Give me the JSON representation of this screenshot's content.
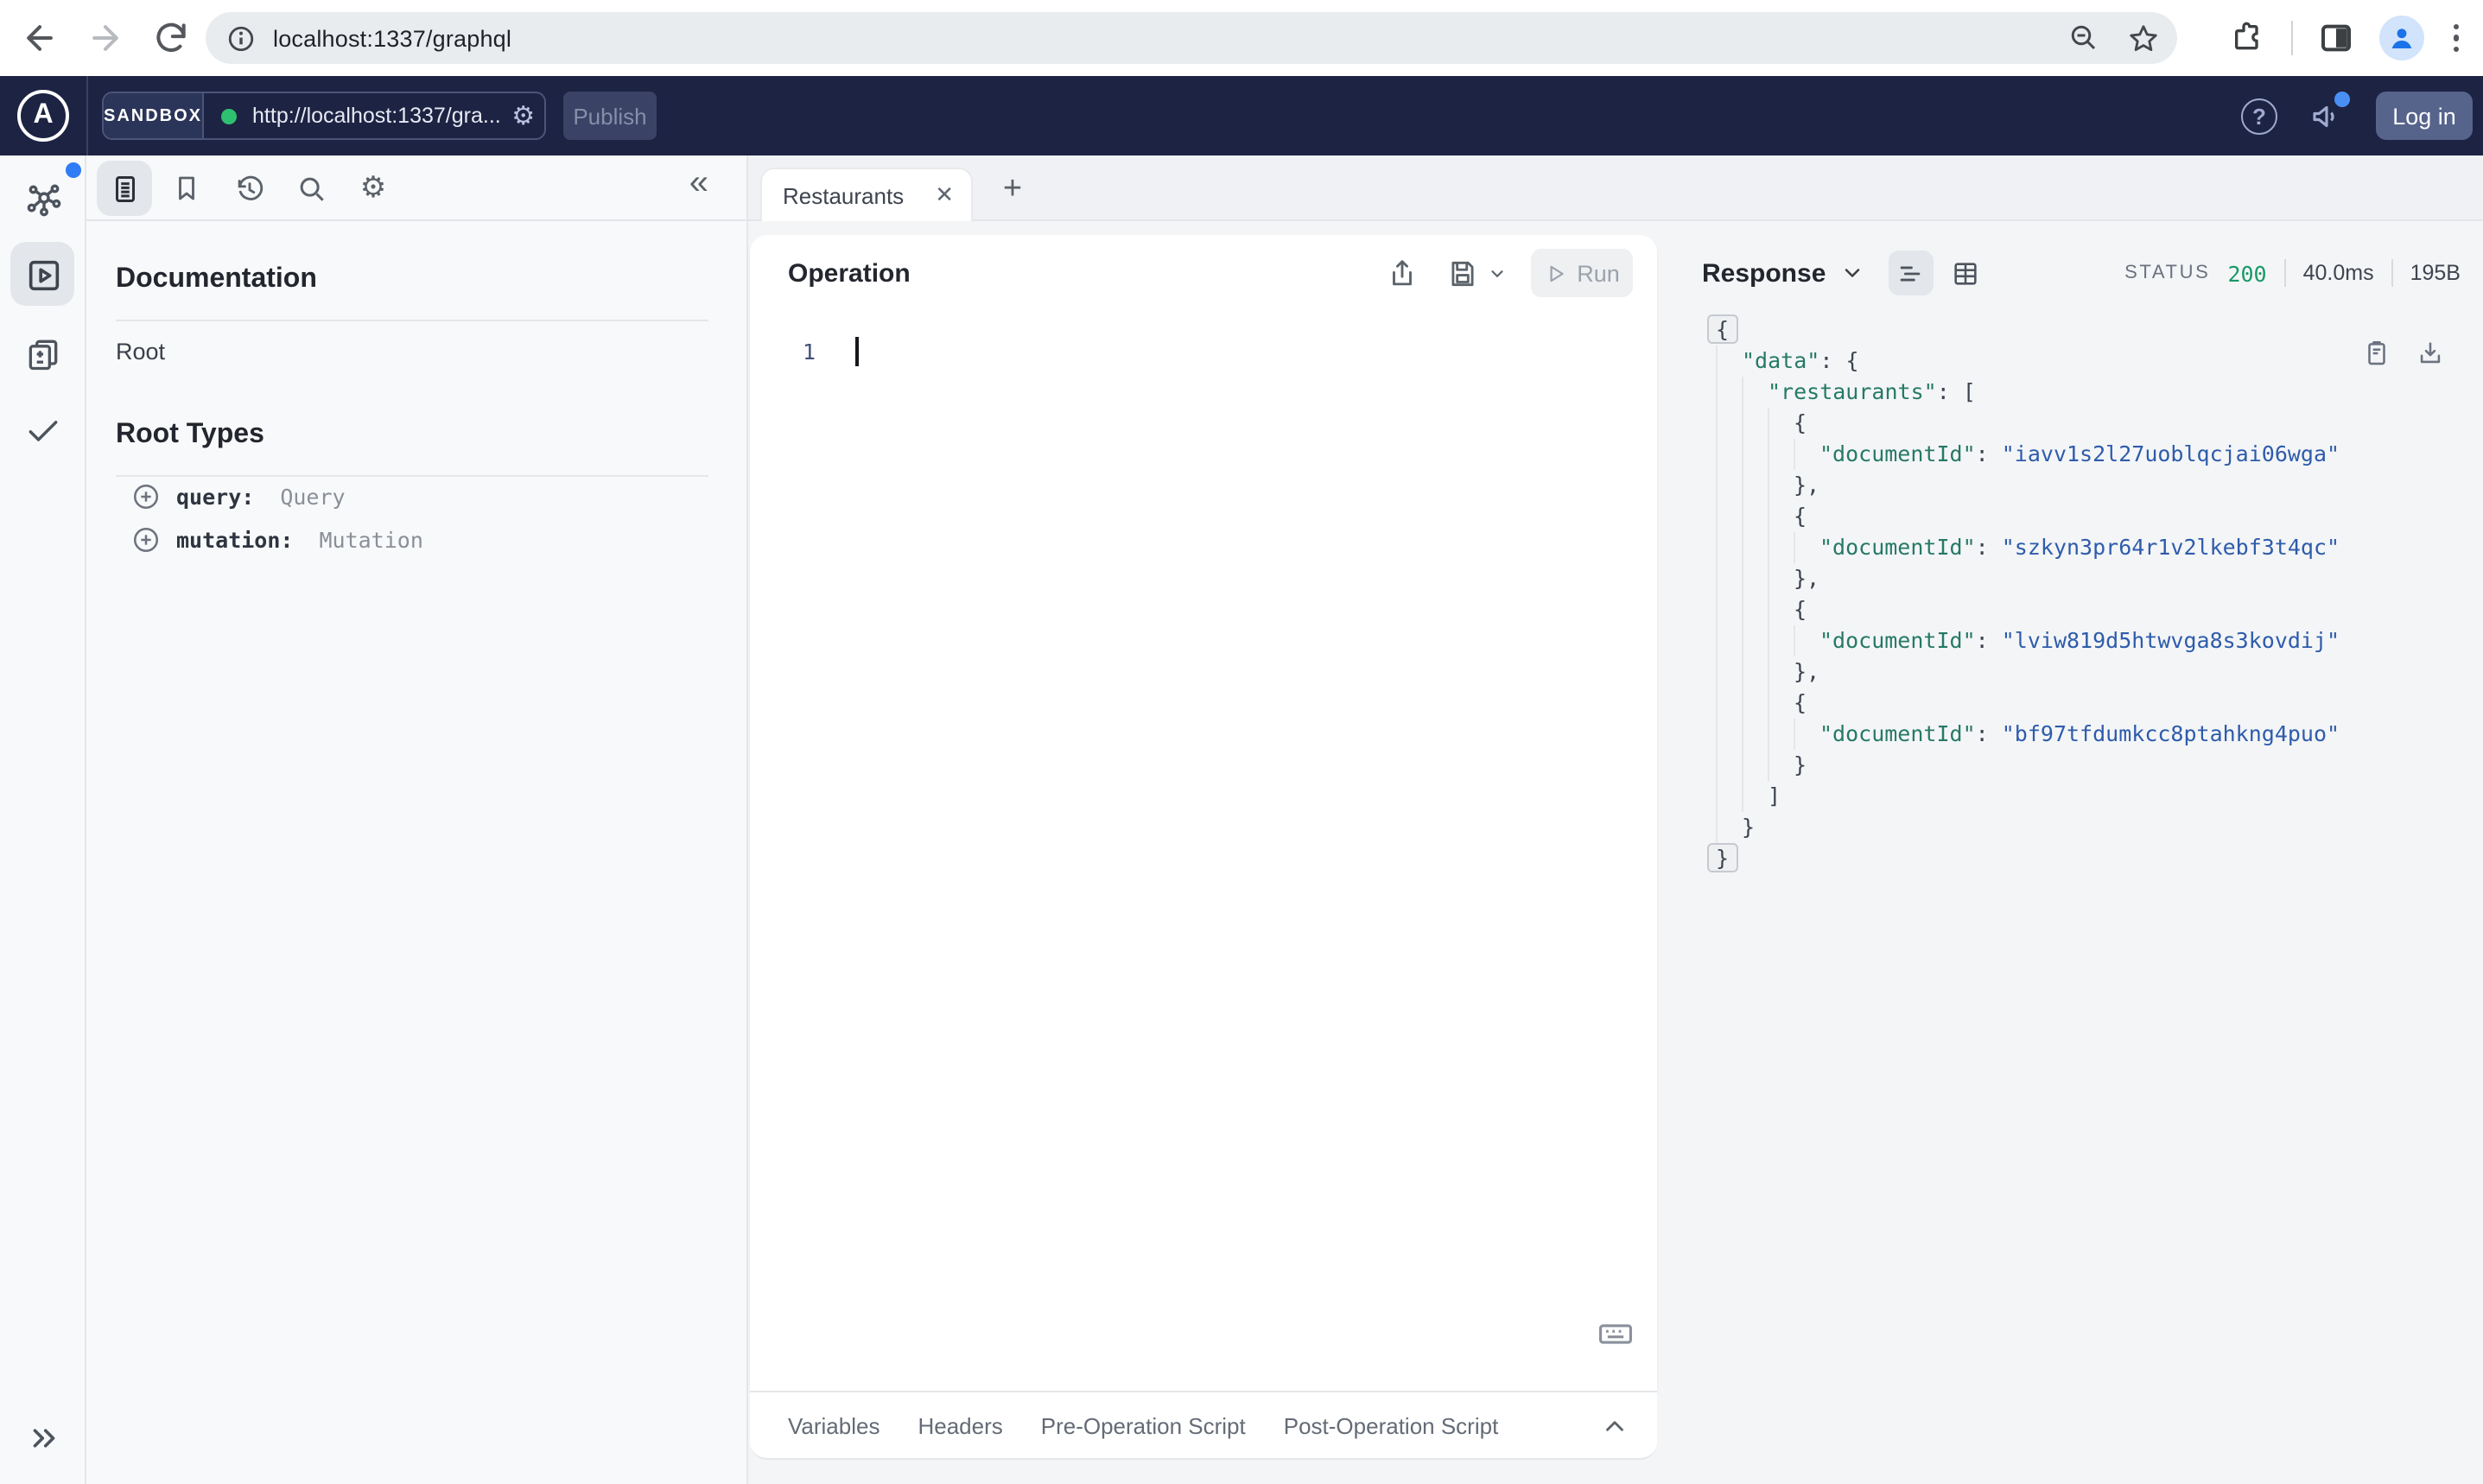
{
  "browser": {
    "url": "localhost:1337/graphql"
  },
  "apollo_header": {
    "logo_letter": "A",
    "env": "SANDBOX",
    "endpoint": "http://localhost:1337/gra...",
    "publish": "Publish",
    "help": "?",
    "login": "Log in"
  },
  "docs": {
    "title": "Documentation",
    "root": "Root",
    "root_types": "Root Types",
    "types": [
      {
        "field": "query:",
        "type": "Query"
      },
      {
        "field": "mutation:",
        "type": "Mutation"
      }
    ]
  },
  "tabs": {
    "active": "Restaurants"
  },
  "operation": {
    "title": "Operation",
    "run": "Run",
    "line_no": "1"
  },
  "footer_tabs": {
    "items": [
      "Variables",
      "Headers",
      "Pre-Operation Script",
      "Post-Operation Script"
    ]
  },
  "response": {
    "title": "Response",
    "status_label": "STATUS",
    "status_code": "200",
    "duration": "40.0ms",
    "size": "195B",
    "json_lines": [
      {
        "i": 0,
        "seg": [
          [
            "{",
            "p",
            "box"
          ]
        ]
      },
      {
        "i": 1,
        "seg": [
          [
            "\"data\"",
            "k"
          ],
          [
            ": ",
            "p"
          ],
          [
            "{",
            "p"
          ]
        ]
      },
      {
        "i": 2,
        "seg": [
          [
            "\"restaurants\"",
            "k"
          ],
          [
            ": ",
            "p"
          ],
          [
            "[",
            "p"
          ]
        ]
      },
      {
        "i": 3,
        "seg": [
          [
            "{",
            "p"
          ]
        ]
      },
      {
        "i": 4,
        "seg": [
          [
            "\"documentId\"",
            "k"
          ],
          [
            ": ",
            "p"
          ],
          [
            "\"iavv1s2l27uoblqcjai06wga\"",
            "s"
          ]
        ]
      },
      {
        "i": 3,
        "seg": [
          [
            "},",
            "p"
          ]
        ]
      },
      {
        "i": 3,
        "seg": [
          [
            "{",
            "p"
          ]
        ]
      },
      {
        "i": 4,
        "seg": [
          [
            "\"documentId\"",
            "k"
          ],
          [
            ": ",
            "p"
          ],
          [
            "\"szkyn3pr64r1v2lkebf3t4qc\"",
            "s"
          ]
        ]
      },
      {
        "i": 3,
        "seg": [
          [
            "},",
            "p"
          ]
        ]
      },
      {
        "i": 3,
        "seg": [
          [
            "{",
            "p"
          ]
        ]
      },
      {
        "i": 4,
        "seg": [
          [
            "\"documentId\"",
            "k"
          ],
          [
            ": ",
            "p"
          ],
          [
            "\"lviw819d5htwvga8s3kovdij\"",
            "s"
          ]
        ]
      },
      {
        "i": 3,
        "seg": [
          [
            "},",
            "p"
          ]
        ]
      },
      {
        "i": 3,
        "seg": [
          [
            "{",
            "p"
          ]
        ]
      },
      {
        "i": 4,
        "seg": [
          [
            "\"documentId\"",
            "k"
          ],
          [
            ": ",
            "p"
          ],
          [
            "\"bf97tfdumkcc8ptahkng4puo\"",
            "s"
          ]
        ]
      },
      {
        "i": 3,
        "seg": [
          [
            "}",
            "p"
          ]
        ]
      },
      {
        "i": 2,
        "seg": [
          [
            "]",
            "p"
          ]
        ]
      },
      {
        "i": 1,
        "seg": [
          [
            "}",
            "p"
          ]
        ]
      },
      {
        "i": 0,
        "seg": [
          [
            "}",
            "p",
            "box"
          ]
        ]
      }
    ]
  },
  "colors": {
    "header_bg": "#1d2342",
    "status_green": "#189a66",
    "json_key": "#257a66",
    "json_string": "#2e5cab",
    "accent_blue": "#2f7cf6"
  }
}
